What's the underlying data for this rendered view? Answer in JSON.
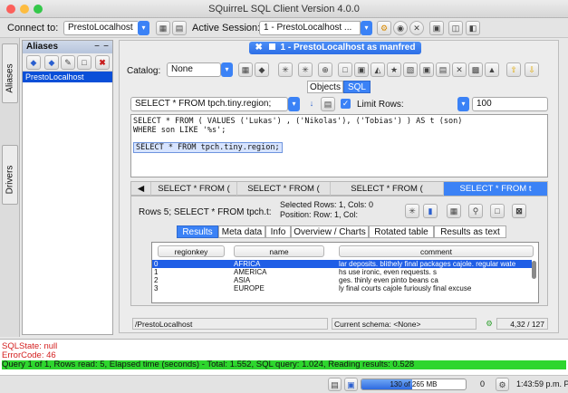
{
  "window": {
    "title": "SQuirreL SQL Client Version 4.0.0",
    "close_color": "#fc605b",
    "min_color": "#fdbc40",
    "max_color": "#34c84a"
  },
  "toolbar": {
    "connect_label": "Connect to:",
    "connect_value": "PrestoLocalhost",
    "active_session_label": "Active Session:",
    "active_session_value": "1 - PrestoLocalhost ..."
  },
  "side_tabs": [
    "Aliases",
    "Drivers"
  ],
  "aliases": {
    "title": "Aliases",
    "items": [
      "PrestoLocalhost"
    ]
  },
  "session": {
    "tab_label": "1 - PrestoLocalhost  as manfred",
    "catalog_label": "Catalog:",
    "catalog_value": "None",
    "view_tabs": [
      "Objects",
      "SQL"
    ],
    "active_view_tab": "SQL",
    "query_combo": "SELECT * FROM tpch.tiny.region;",
    "limit_label": "Limit Rows:",
    "limit_value": "100",
    "editor_lines": [
      "SELECT * FROM ( VALUES ('Lukas') , ('Nikolas'), ('Tobias') ) AS t (son)",
      "WHERE son LIKE '%s';"
    ],
    "editor_selected": "SELECT * FROM tpch.tiny.region;",
    "result_tabs": [
      "SELECT * FROM (",
      "SELECT * FROM (",
      "SELECT * FROM (",
      "SELECT * FROM t"
    ],
    "result_summary": "Rows 5;  SELECT * FROM tpch.t:",
    "selected_info": "Selected Rows: 1, Cols: 0",
    "position_info": "Position: Row: 1, Col:",
    "sub_tabs": [
      "Results",
      "Meta data",
      "Info",
      "Overview / Charts",
      "Rotated table",
      "Results as text"
    ],
    "active_sub_tab": "Results",
    "columns": [
      "regionkey",
      "name",
      "comment"
    ],
    "rows": [
      [
        "0",
        "AFRICA",
        "lar deposits. blithely final packages cajole. regular wate"
      ],
      [
        "1",
        "AMERICA",
        "hs use ironic, even requests. s"
      ],
      [
        "2",
        "ASIA",
        "ges. thinly even pinto beans ca"
      ],
      [
        "3",
        "EUROPE",
        "ly final courts cajole furiously final excuse"
      ]
    ],
    "status_alias": "/PrestoLocalhost",
    "status_schema": "Current schema:  <None>",
    "status_position": "4,32 / 127"
  },
  "log": {
    "lines": [
      {
        "text": "SQLState:  null",
        "color": "#d42020"
      },
      {
        "text": "ErrorCode: 46",
        "color": "#d42020"
      },
      {
        "text": "Query 1 of 1, Rows read: 5, Elapsed time (seconds) - Total: 1.552, SQL query: 1.024, Reading results: 0.528",
        "color": "#111111"
      }
    ],
    "success_bg": "#2ed62e"
  },
  "bottom": {
    "memory": "130 of 265 MB",
    "memory_fraction": 0.49,
    "counter": "0",
    "time": "1:43:59 p.m. PST"
  }
}
